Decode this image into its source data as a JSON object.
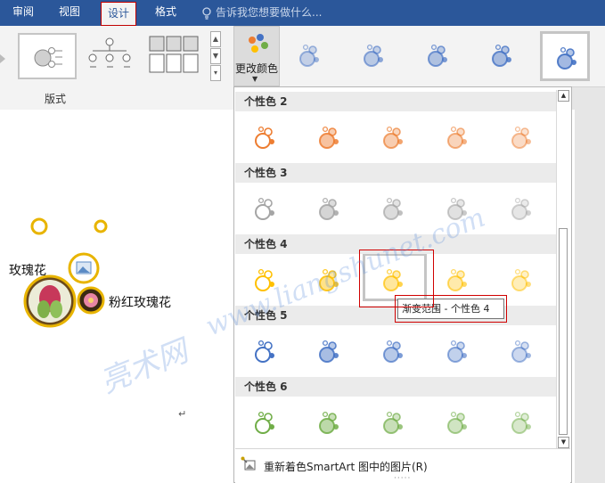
{
  "tabs": [
    {
      "label": "审阅"
    },
    {
      "label": "视图"
    },
    {
      "label": "设计"
    },
    {
      "label": "格式"
    }
  ],
  "tell_me": {
    "placeholder": "告诉我您想要做什么..."
  },
  "ribbon": {
    "layout_group_label": "版式",
    "change_color_label": "更改颜色"
  },
  "gallery": {
    "sections": [
      {
        "title": "个性色 2",
        "color": "#ed7d31"
      },
      {
        "title": "个性色 3",
        "color": "#a5a5a5"
      },
      {
        "title": "个性色 4",
        "color": "#ffc000"
      },
      {
        "title": "个性色 5",
        "color": "#4472c4"
      },
      {
        "title": "个性色 6",
        "color": "#70ad47"
      }
    ],
    "tooltip": "渐变范围 - 个性色 4",
    "footer_label": "重新着色SmartArt 图中的图片(R)"
  },
  "document": {
    "labels": [
      "玫瑰花",
      "粉红玫瑰花"
    ],
    "paragraph_mark": "↵"
  },
  "watermark": {
    "line1": "www.liangshunet.com",
    "line2": "亮术网"
  },
  "colors": {
    "ribbon_blue": "#2b579a",
    "accent_red": "#d00000"
  }
}
